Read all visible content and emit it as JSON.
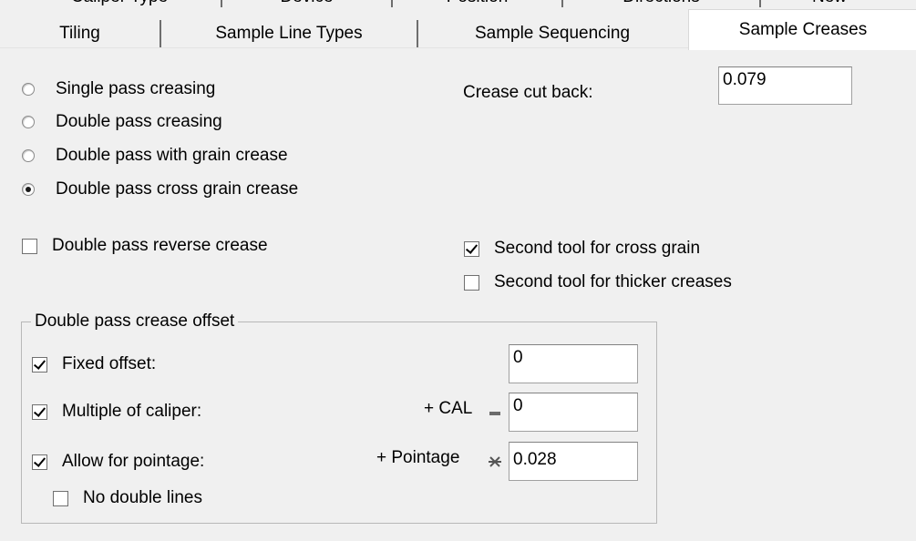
{
  "tabs_back": [
    "Caliper Type",
    "Device",
    "Position",
    "Directions",
    "New"
  ],
  "tabs": {
    "tiling": "Tiling",
    "sample_line_types": "Sample Line Types",
    "sample_sequencing": "Sample Sequencing",
    "sample_creases": "Sample Creases"
  },
  "creasing_mode": {
    "options": [
      "Single pass creasing",
      "Double pass creasing",
      "Double pass with grain crease",
      "Double pass cross grain crease"
    ],
    "selected": "Double pass cross grain crease"
  },
  "crease_cut_back": {
    "label": "Crease cut back:",
    "value": "0.079"
  },
  "double_pass_reverse_crease": {
    "label": "Double pass reverse crease",
    "checked": false
  },
  "second_tool_cross_grain": {
    "label": "Second tool for cross grain",
    "checked": true
  },
  "second_tool_thicker_creases": {
    "label": "Second tool for thicker creases",
    "checked": false
  },
  "offset_group": {
    "title": "Double pass crease offset",
    "fixed_offset": {
      "label": "Fixed offset:",
      "checked": true,
      "value": "0"
    },
    "multiple_of_caliper": {
      "label": "Multiple of caliper:",
      "checked": true,
      "prefix": "+ CAL",
      "value": "0"
    },
    "allow_for_pointage": {
      "label": "Allow for pointage:",
      "checked": true,
      "prefix": "+ Pointage",
      "value": "0.028"
    },
    "no_double_lines": {
      "label": "No double lines",
      "checked": false
    }
  }
}
